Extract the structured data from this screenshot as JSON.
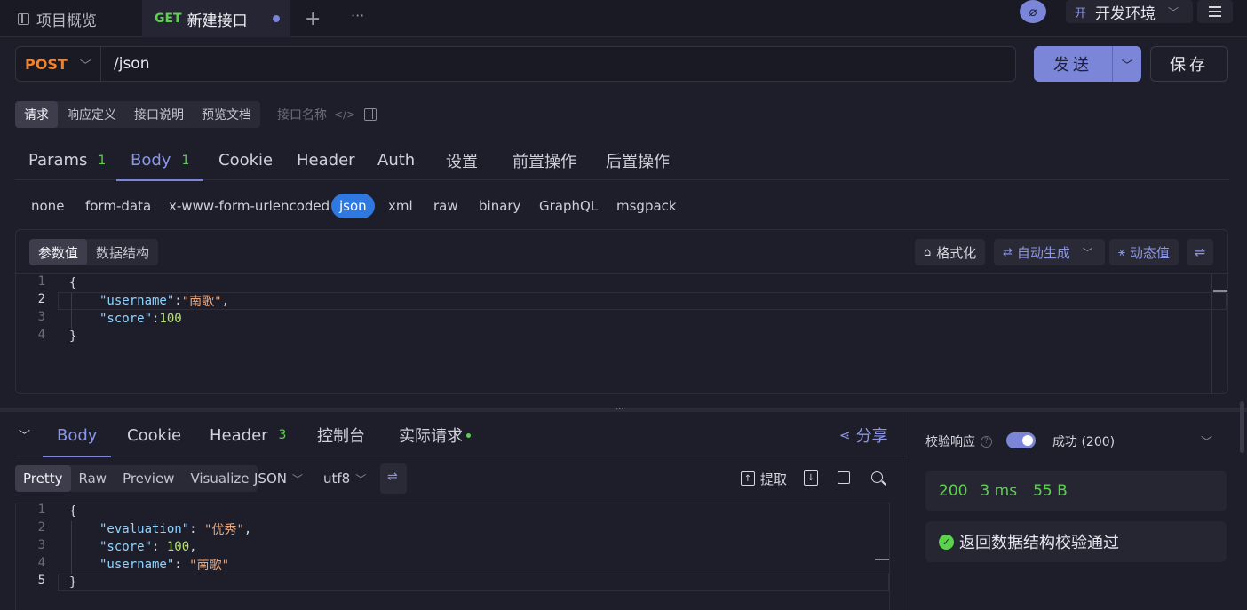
{
  "tabs": {
    "overview": "项目概览",
    "active_method": "GET",
    "active_title": "新建接口",
    "add": "+",
    "more": "···"
  },
  "env": {
    "badge": "开",
    "name": "开发环境"
  },
  "request": {
    "method": "POST",
    "path": "/json",
    "send_label": "发送",
    "save_label": "保存"
  },
  "mode_tabs": [
    "请求",
    "响应定义",
    "接口说明",
    "预览文档"
  ],
  "interface_name_placeholder": "接口名称",
  "req_tabs": [
    {
      "label": "Params",
      "count": "1"
    },
    {
      "label": "Body",
      "count": "1"
    },
    {
      "label": "Cookie"
    },
    {
      "label": "Header"
    },
    {
      "label": "Auth"
    },
    {
      "label": "设置"
    },
    {
      "label": "前置操作"
    },
    {
      "label": "后置操作"
    }
  ],
  "body_types": [
    "none",
    "form-data",
    "x-www-form-urlencoded",
    "json",
    "xml",
    "raw",
    "binary",
    "GraphQL",
    "msgpack"
  ],
  "editor": {
    "seg": [
      "参数值",
      "数据结构"
    ],
    "tools": {
      "format": "格式化",
      "auto": "自动生成",
      "dynamic": "动态值"
    }
  },
  "request_body_lines": [
    {
      "n": "1",
      "t": "{"
    },
    {
      "n": "2",
      "key": "\"username\"",
      "sep": ":",
      "val": "\"南歌\"",
      "end": ","
    },
    {
      "n": "3",
      "key": "\"score\"",
      "sep": ":",
      "num": "100",
      "end": ""
    },
    {
      "n": "4",
      "t": "}"
    }
  ],
  "resp_tabs": [
    {
      "label": "Body"
    },
    {
      "label": "Cookie"
    },
    {
      "label": "Header",
      "count": "3"
    },
    {
      "label": "控制台"
    },
    {
      "label": "实际请求"
    }
  ],
  "share": "分享",
  "fmt_tabs": [
    "Pretty",
    "Raw",
    "Preview",
    "Visualize"
  ],
  "fmt_type": "JSON",
  "encoding": "utf8",
  "extract": "提取",
  "response_body_lines": [
    {
      "n": "1",
      "t": "{"
    },
    {
      "n": "2",
      "key": "\"evaluation\"",
      "sep": ": ",
      "val": "\"优秀\"",
      "end": ","
    },
    {
      "n": "3",
      "key": "\"score\"",
      "sep": ": ",
      "num": "100",
      "end": ","
    },
    {
      "n": "4",
      "key": "\"username\"",
      "sep": ": ",
      "val": "\"南歌\"",
      "end": ""
    },
    {
      "n": "5",
      "t": "}"
    }
  ],
  "validation": {
    "label": "校验响应",
    "result": "成功 (200)",
    "status": "200",
    "time": "3 ms",
    "size": "55 B",
    "message": "返回数据结构校验通过"
  },
  "colors": {
    "accent": "#7b86d8",
    "post": "#f2812a",
    "get": "#5bd14e",
    "json_active": "#2f78e0"
  }
}
